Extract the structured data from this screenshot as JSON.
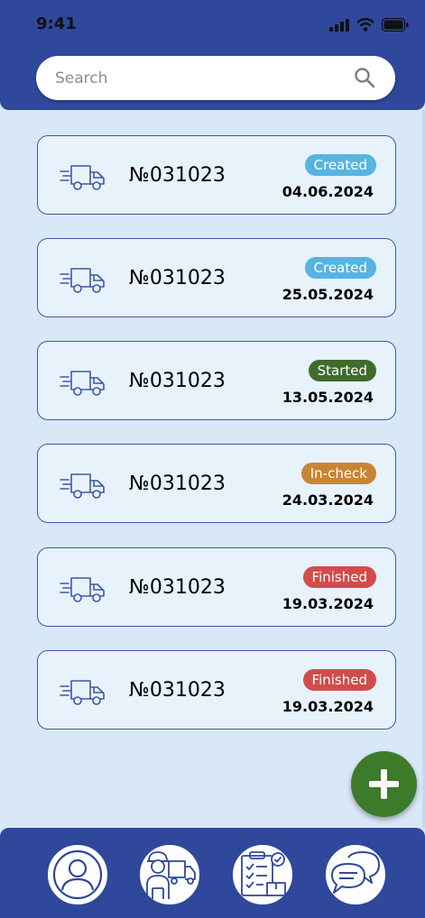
{
  "status_bar": {
    "time": "9:41"
  },
  "search": {
    "placeholder": "Search"
  },
  "orders": [
    {
      "number": "№031023",
      "status": "Created",
      "date": "04.06.2024",
      "status_color": "#57b4e0"
    },
    {
      "number": "№031023",
      "status": "Created",
      "date": "25.05.2024",
      "status_color": "#57b4e0"
    },
    {
      "number": "№031023",
      "status": "Started",
      "date": "13.05.2024",
      "status_color": "#3f6c2c"
    },
    {
      "number": "№031023",
      "status": "In-check",
      "date": "24.03.2024",
      "status_color": "#c98532"
    },
    {
      "number": "№031023",
      "status": "Finished",
      "date": "19.03.2024",
      "status_color": "#d24c4c"
    },
    {
      "number": "№031023",
      "status": "Finished",
      "date": "19.03.2024",
      "status_color": "#d24c4c"
    }
  ],
  "fab": {
    "icon": "plus-icon",
    "color": "#3d7a2a"
  },
  "bottom_nav": [
    {
      "icon": "profile-icon"
    },
    {
      "icon": "driver-truck-icon"
    },
    {
      "icon": "checklist-delivery-icon"
    },
    {
      "icon": "chat-icon"
    }
  ],
  "colors": {
    "primary": "#2f489c",
    "background": "#d9e8f6",
    "card": "#e8f2fb"
  }
}
